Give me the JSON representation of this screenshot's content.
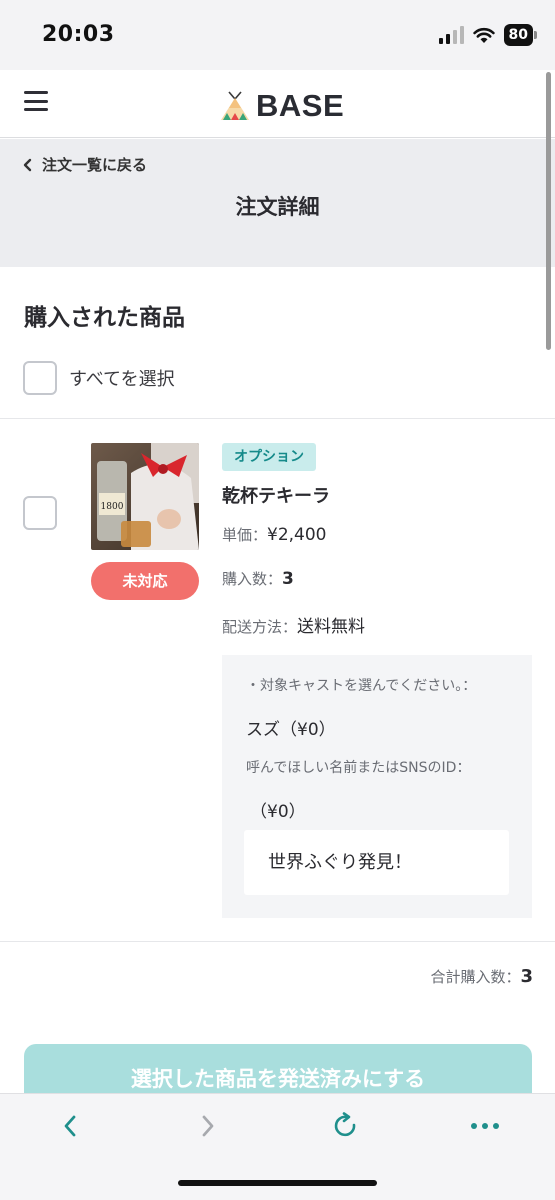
{
  "status_bar": {
    "time": "20:03",
    "battery_level": "80",
    "icons": [
      "signal-icon",
      "wifi-icon",
      "battery-icon"
    ]
  },
  "header": {
    "brand": "BASE",
    "icons": [
      "hamburger-menu-icon",
      "base-logo-icon"
    ]
  },
  "page": {
    "back_label": "注文一覧に戻る",
    "title": "注文詳細"
  },
  "purchased": {
    "section_title": "購入された商品",
    "select_all_label": "すべてを選択",
    "item": {
      "status": "未対応",
      "badge": "オプション",
      "name": "乾杯テキーラ",
      "unit_price_label": "単価：",
      "unit_price": "¥2,400",
      "quantity_label": "購入数：",
      "quantity": "3",
      "shipping_label": "配送方法：",
      "shipping": "送料無料",
      "options": {
        "q1": "・対象キャストを選んでください。：",
        "a1": "スズ（¥0）",
        "q2": "呼んでほしい名前またはSNSのID：",
        "a2": "（¥0）",
        "text_value": "世界ふぐり発見！"
      }
    },
    "total_label": "合計購入数：",
    "total": "3",
    "ship_button_label": "選択した商品を発送済みにする"
  },
  "colors": {
    "accent": "#a9dedd",
    "status_pill": "#f2706c",
    "badge_bg": "#c9ecec",
    "badge_text": "#158a8a",
    "browser_icon": "#1f8f8c"
  },
  "browser": {
    "icons": [
      "back-arrow-icon",
      "forward-arrow-icon",
      "reload-icon",
      "more-dots-icon"
    ]
  }
}
